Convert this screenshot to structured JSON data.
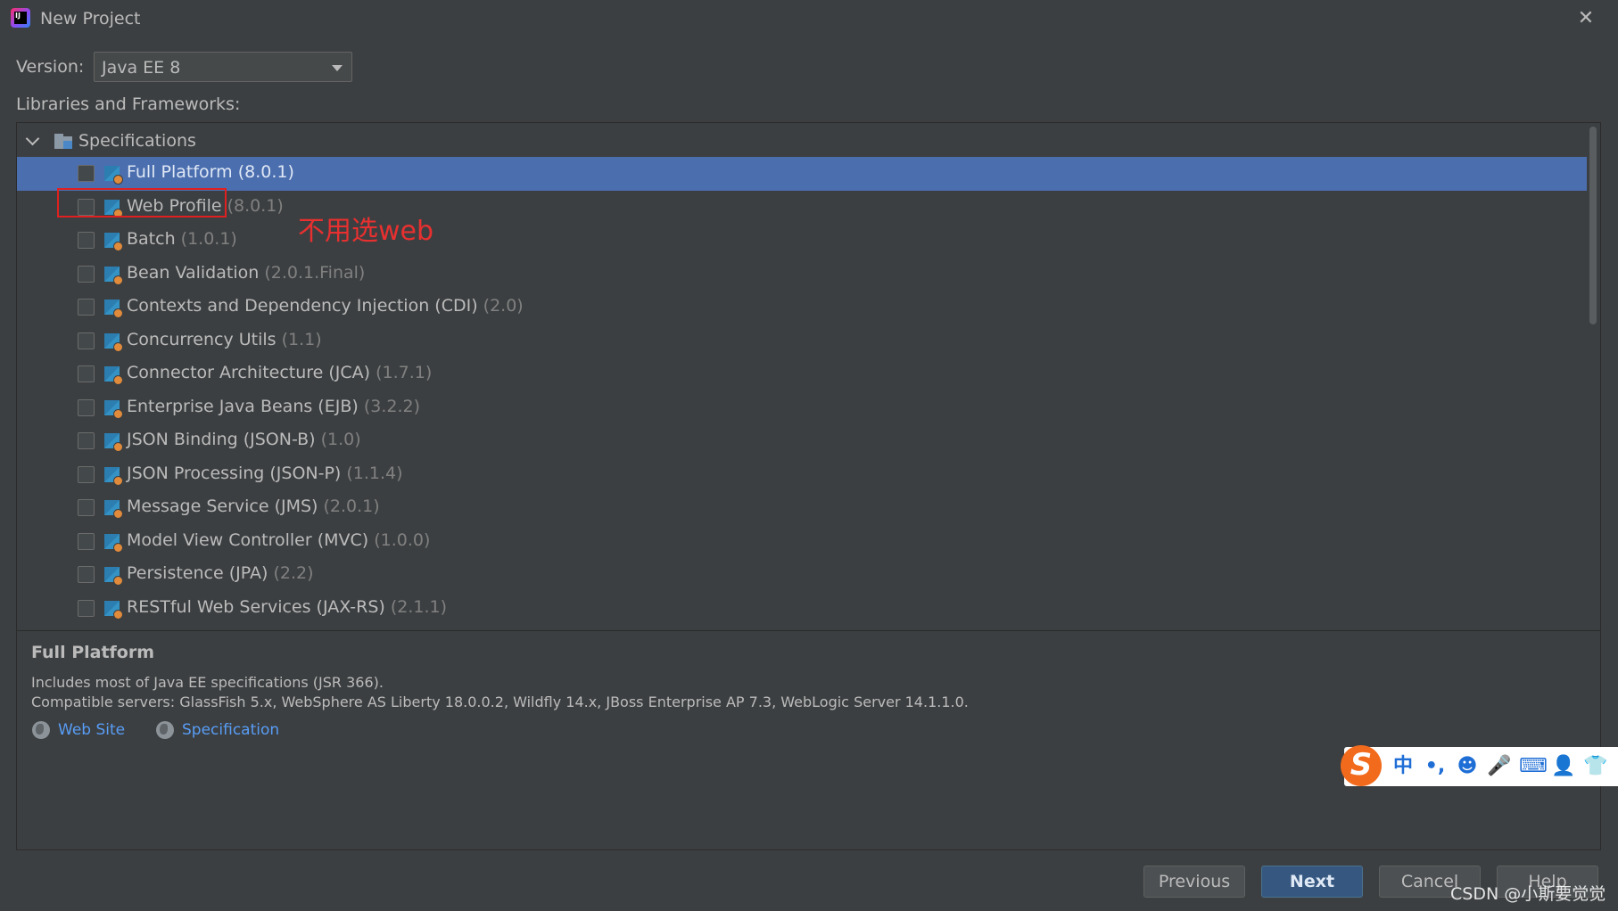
{
  "window": {
    "title": "New Project",
    "close_icon": "close-icon"
  },
  "version": {
    "label": "Version:",
    "value": "Java EE 8"
  },
  "libraries_label": "Libraries and Frameworks:",
  "tree": {
    "root_label": "Specifications",
    "items": [
      {
        "name": "Full Platform",
        "version": "(8.0.1)",
        "checked": false,
        "selected": true
      },
      {
        "name": "Web Profile",
        "version": "(8.0.1)",
        "checked": false,
        "selected": false
      },
      {
        "name": "Batch",
        "version": "(1.0.1)",
        "checked": false,
        "selected": false
      },
      {
        "name": "Bean Validation",
        "version": "(2.0.1.Final)",
        "checked": false,
        "selected": false
      },
      {
        "name": "Contexts and Dependency Injection (CDI)",
        "version": "(2.0)",
        "checked": false,
        "selected": false
      },
      {
        "name": "Concurrency Utils",
        "version": "(1.1)",
        "checked": false,
        "selected": false
      },
      {
        "name": "Connector Architecture (JCA)",
        "version": "(1.7.1)",
        "checked": false,
        "selected": false
      },
      {
        "name": "Enterprise Java Beans (EJB)",
        "version": "(3.2.2)",
        "checked": false,
        "selected": false
      },
      {
        "name": "JSON Binding (JSON-B)",
        "version": "(1.0)",
        "checked": false,
        "selected": false
      },
      {
        "name": "JSON Processing (JSON-P)",
        "version": "(1.1.4)",
        "checked": false,
        "selected": false
      },
      {
        "name": "Message Service (JMS)",
        "version": "(2.0.1)",
        "checked": false,
        "selected": false
      },
      {
        "name": "Model View Controller (MVC)",
        "version": "(1.0.0)",
        "checked": false,
        "selected": false
      },
      {
        "name": "Persistence (JPA)",
        "version": "(2.2)",
        "checked": false,
        "selected": false
      },
      {
        "name": "RESTful Web Services (JAX-RS)",
        "version": "(2.1.1)",
        "checked": false,
        "selected": false
      }
    ]
  },
  "annotation": {
    "text": "不用选web",
    "color": "#e83030"
  },
  "description": {
    "title": "Full Platform",
    "line1": "Includes most of Java EE specifications (JSR 366).",
    "line2": "Compatible servers: GlassFish 5.x, WebSphere AS Liberty 18.0.0.2, Wildfly 14.x, JBoss Enterprise AP 7.3, WebLogic Server 14.1.1.0.",
    "link_website": "Web Site",
    "link_spec": "Specification"
  },
  "buttons": {
    "previous": "Previous",
    "next": "Next",
    "cancel": "Cancel",
    "help": "Help"
  },
  "ime_toolbar": {
    "logo": "S",
    "lang": "中",
    "punct": "•,",
    "emoji": "☻",
    "mic": "🎤",
    "keyboard": "⌨",
    "user": "👤",
    "skin": "👕"
  },
  "watermark": "CSDN @小斯要觉觉",
  "colors": {
    "background": "#3c3f41",
    "selection": "#4b6eaf",
    "link": "#589df6",
    "primary_button": "#365880"
  }
}
